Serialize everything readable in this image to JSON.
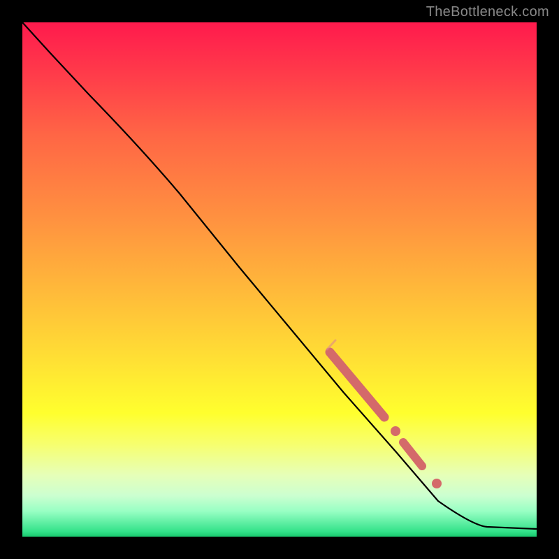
{
  "watermark": "TheBottleneck.com",
  "chart_data": {
    "type": "line",
    "title": "",
    "xlabel": "",
    "ylabel": "",
    "xlim": [
      0,
      100
    ],
    "ylim": [
      0,
      100
    ],
    "grid": false,
    "legend": false,
    "gradient_stops": [
      {
        "pct": 0,
        "color": "#ff1a4d"
      },
      {
        "pct": 10,
        "color": "#ff3b4a"
      },
      {
        "pct": 22,
        "color": "#ff6645"
      },
      {
        "pct": 38,
        "color": "#ff9140"
      },
      {
        "pct": 52,
        "color": "#ffb93a"
      },
      {
        "pct": 66,
        "color": "#ffe134"
      },
      {
        "pct": 76,
        "color": "#ffff2e"
      },
      {
        "pct": 82,
        "color": "#f7ff6e"
      },
      {
        "pct": 88,
        "color": "#e6ffb8"
      },
      {
        "pct": 92,
        "color": "#ccffd0"
      },
      {
        "pct": 95,
        "color": "#99ffc4"
      },
      {
        "pct": 99,
        "color": "#33e28a"
      },
      {
        "pct": 100,
        "color": "#19c96e"
      }
    ],
    "series": [
      {
        "name": "curve",
        "color": "#000000",
        "x": [
          0,
          5,
          12,
          20,
          28,
          40,
          50,
          60,
          70,
          80,
          88,
          94,
          100
        ],
        "y": [
          100,
          94,
          86,
          78,
          70,
          56,
          44,
          32,
          20,
          10,
          3,
          2,
          2
        ]
      }
    ],
    "markers": [
      {
        "name": "highlight-band",
        "color": "#d46a6a",
        "shape": "thick-segment",
        "x_range": [
          58,
          68
        ],
        "y_range": [
          36,
          23
        ]
      },
      {
        "name": "highlight-dot-1",
        "color": "#d46a6a",
        "shape": "dot",
        "x": 70,
        "y": 20
      },
      {
        "name": "highlight-band-2",
        "color": "#d46a6a",
        "shape": "thick-segment",
        "x_range": [
          72,
          76
        ],
        "y_range": [
          18,
          13
        ]
      },
      {
        "name": "highlight-dot-2",
        "color": "#d46a6a",
        "shape": "dot",
        "x": 79,
        "y": 10
      }
    ]
  }
}
